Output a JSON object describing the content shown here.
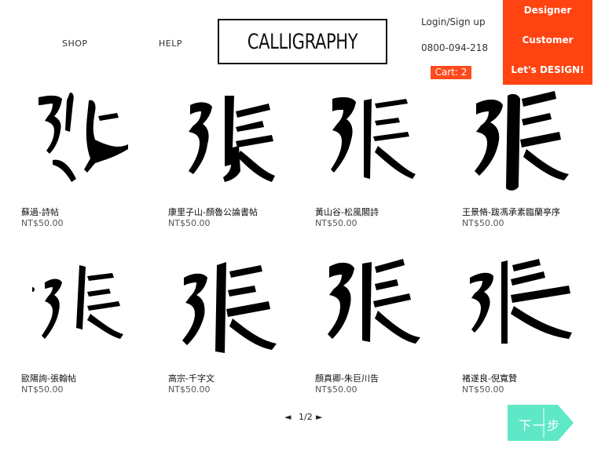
{
  "nav": {
    "shop": "SHOP",
    "help": "HELP"
  },
  "logo": {
    "text": "CALLIGRAPHY"
  },
  "account": {
    "login": "Login/Sign up",
    "phone": "0800-094-218",
    "cart": "Cart: 2"
  },
  "promo": {
    "line1": "Designer",
    "line2": "Customer",
    "line3": "Let's DESIGN!"
  },
  "products": [
    {
      "title": "蘇過-詩帖",
      "price": "NT$50.00",
      "image": "calligraphy-zhang-character"
    },
    {
      "title": "康里子山-顏魯公論書帖",
      "price": "NT$50.00",
      "image": "calligraphy-zhang-character"
    },
    {
      "title": "黃山谷-松風閣詩",
      "price": "NT$50.00",
      "image": "calligraphy-zhang-character"
    },
    {
      "title": "王景脩-跋馮承素臨蘭亭序",
      "price": "NT$50.00",
      "image": "calligraphy-zhang-character"
    },
    {
      "title": "歐陽詢-張翰帖",
      "price": "NT$50.00",
      "image": "calligraphy-zhang-character"
    },
    {
      "title": "高宗-千字文",
      "price": "NT$50.00",
      "image": "calligraphy-zhang-character"
    },
    {
      "title": "顏真卿-朱巨川告",
      "price": "NT$50.00",
      "image": "calligraphy-zhang-character"
    },
    {
      "title": "褚遂良-倪寬贊",
      "price": "NT$50.00",
      "image": "calligraphy-zhang-character"
    }
  ],
  "pagination": {
    "prev": "◄",
    "page": "1/2",
    "next": "►"
  },
  "next_step": {
    "label": "下一步"
  },
  "colors": {
    "accent": "#ff4412",
    "next_button": "#5fe8c8"
  }
}
